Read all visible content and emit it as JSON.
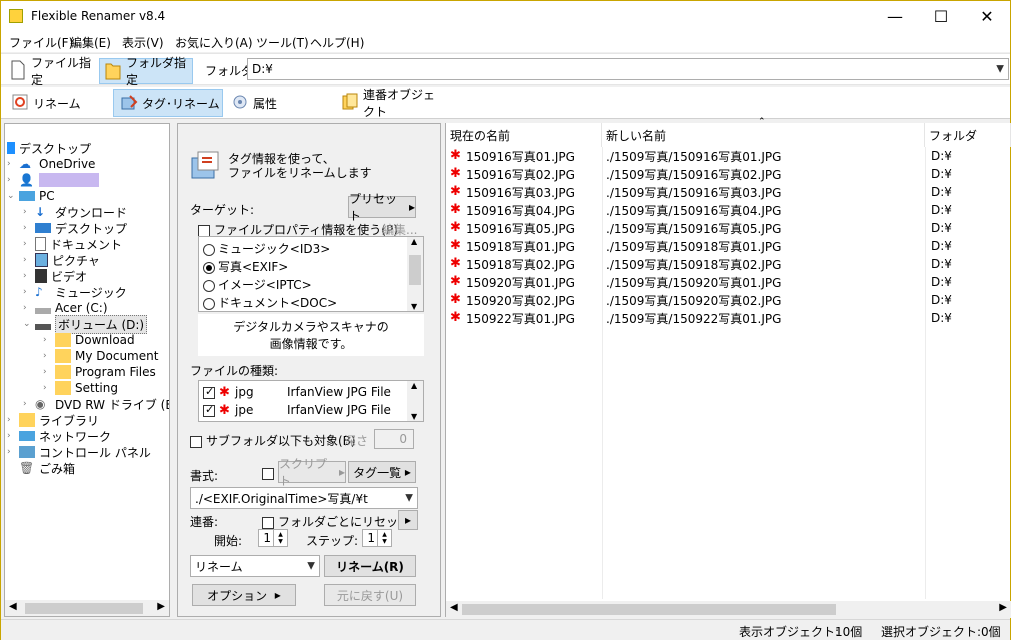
{
  "window": {
    "title": "Flexible Renamer v8.4",
    "minimize": "—",
    "maximize": "☐",
    "close": "✕"
  },
  "menu": [
    "ファイル(F)",
    "編集(E)",
    "表示(V)",
    "お気に入り(A)",
    "ツール(T)",
    "ヘルプ(H)"
  ],
  "toolbar": {
    "file_mode": "ファイル指定",
    "folder_mode": "フォルダ指定",
    "folder_label": "フォルダ",
    "folder_path": "D:¥"
  },
  "tabs": {
    "rename": "リネーム",
    "tag_rename": "タグ･リネーム",
    "attr": "属性",
    "serial": "連番オブジェクト"
  },
  "tree": {
    "items": [
      "デスクトップ",
      "OneDrive",
      "",
      "PC",
      "ダウンロード",
      "デスクトップ",
      "ドキュメント",
      "ピクチャ",
      "ビデオ",
      "ミュージック",
      "Acer (C:)",
      "ボリューム (D:)",
      "Download",
      "My Document",
      "Program Files",
      "Setting",
      "DVD RW ドライブ (E:)",
      "ライブラリ",
      "ネットワーク",
      "コントロール パネル",
      "ごみ箱"
    ]
  },
  "panel": {
    "heading_line1": "タグ情報を使って、",
    "heading_line2": "ファイルをリネームします",
    "target_label": "ターゲット:",
    "preset": "プリセット",
    "use_file_prop": "ファイルプロパティ情報を使う(P)",
    "edit": "編集...",
    "targets": [
      "ミュージック<ID3>",
      "写真<EXIF>",
      "イメージ<IPTC>",
      "ドキュメント<DOC>"
    ],
    "desc_line1": "デジタルカメラやスキャナの",
    "desc_line2": "画像情報です。",
    "filetype_label": "ファイルの種類:",
    "filetypes": [
      {
        "ext": "jpg",
        "desc": "IrfanView JPG File"
      },
      {
        "ext": "jpe",
        "desc": "IrfanView JPG File"
      }
    ],
    "subfolder": "サブフォルダ以下も対象(B)",
    "depth_label": "深さ",
    "depth_value": "0",
    "format_label": "書式:",
    "script": "スクリプト",
    "tag_list": "タグ一覧",
    "format_value": "./<EXIF.OriginalTime>写真/¥t",
    "serial_label": "連番:",
    "reset_per_folder": "フォルダごとにリセット",
    "start_label": "開始:",
    "start_value": "1",
    "step_label": "ステップ:",
    "step_value": "1",
    "mode_value": "リネーム",
    "rename_btn": "リネーム(R)",
    "options_btn": "オプション",
    "undo_btn": "元に戻す(U)"
  },
  "list": {
    "headers": {
      "current": "現在の名前",
      "new": "新しい名前",
      "folder": "フォルダ"
    },
    "rows": [
      {
        "cur": "150916写真01.JPG",
        "new": "./1509写真/150916写真01.JPG",
        "folder": "D:¥"
      },
      {
        "cur": "150916写真02.JPG",
        "new": "./1509写真/150916写真02.JPG",
        "folder": "D:¥"
      },
      {
        "cur": "150916写真03.JPG",
        "new": "./1509写真/150916写真03.JPG",
        "folder": "D:¥"
      },
      {
        "cur": "150916写真04.JPG",
        "new": "./1509写真/150916写真04.JPG",
        "folder": "D:¥"
      },
      {
        "cur": "150916写真05.JPG",
        "new": "./1509写真/150916写真05.JPG",
        "folder": "D:¥"
      },
      {
        "cur": "150918写真01.JPG",
        "new": "./1509写真/150918写真01.JPG",
        "folder": "D:¥"
      },
      {
        "cur": "150918写真02.JPG",
        "new": "./1509写真/150918写真02.JPG",
        "folder": "D:¥"
      },
      {
        "cur": "150920写真01.JPG",
        "new": "./1509写真/150920写真01.JPG",
        "folder": "D:¥"
      },
      {
        "cur": "150920写真02.JPG",
        "new": "./1509写真/150920写真02.JPG",
        "folder": "D:¥"
      },
      {
        "cur": "150922写真01.JPG",
        "new": "./1509写真/150922写真01.JPG",
        "folder": "D:¥"
      }
    ]
  },
  "status": {
    "display_label": "表示オブジェクト:",
    "display_count": "10個",
    "selected_label": "選択オブジェクト:",
    "selected_count": "0個"
  }
}
